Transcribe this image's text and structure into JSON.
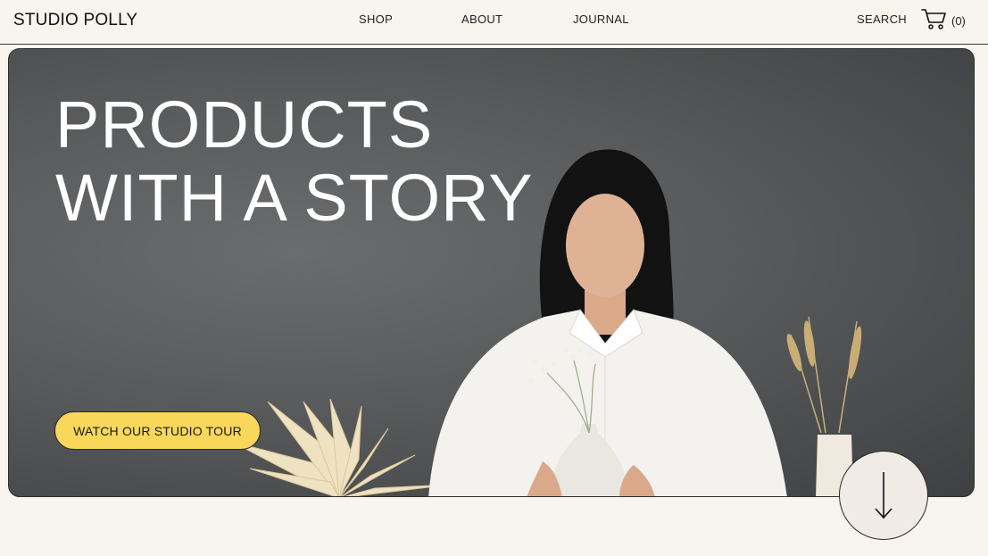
{
  "brand": {
    "name": "STUDIO POLLY"
  },
  "nav": {
    "links": [
      {
        "label": "SHOP"
      },
      {
        "label": "ABOUT"
      },
      {
        "label": "JOURNAL"
      }
    ],
    "search_label": "SEARCH",
    "cart_count": "(0)",
    "cart_icon": "cart-icon"
  },
  "hero": {
    "title_line1": "PRODUCTS",
    "title_line2": "WITH A STORY",
    "cta_label": "WATCH OUR STUDIO TOUR",
    "scroll_icon": "arrow-down-icon"
  },
  "colors": {
    "background": "#f8f4ee",
    "cta": "#f8d75a",
    "hero_bg": "#58595a",
    "scroll_button": "#f0ebe5"
  }
}
